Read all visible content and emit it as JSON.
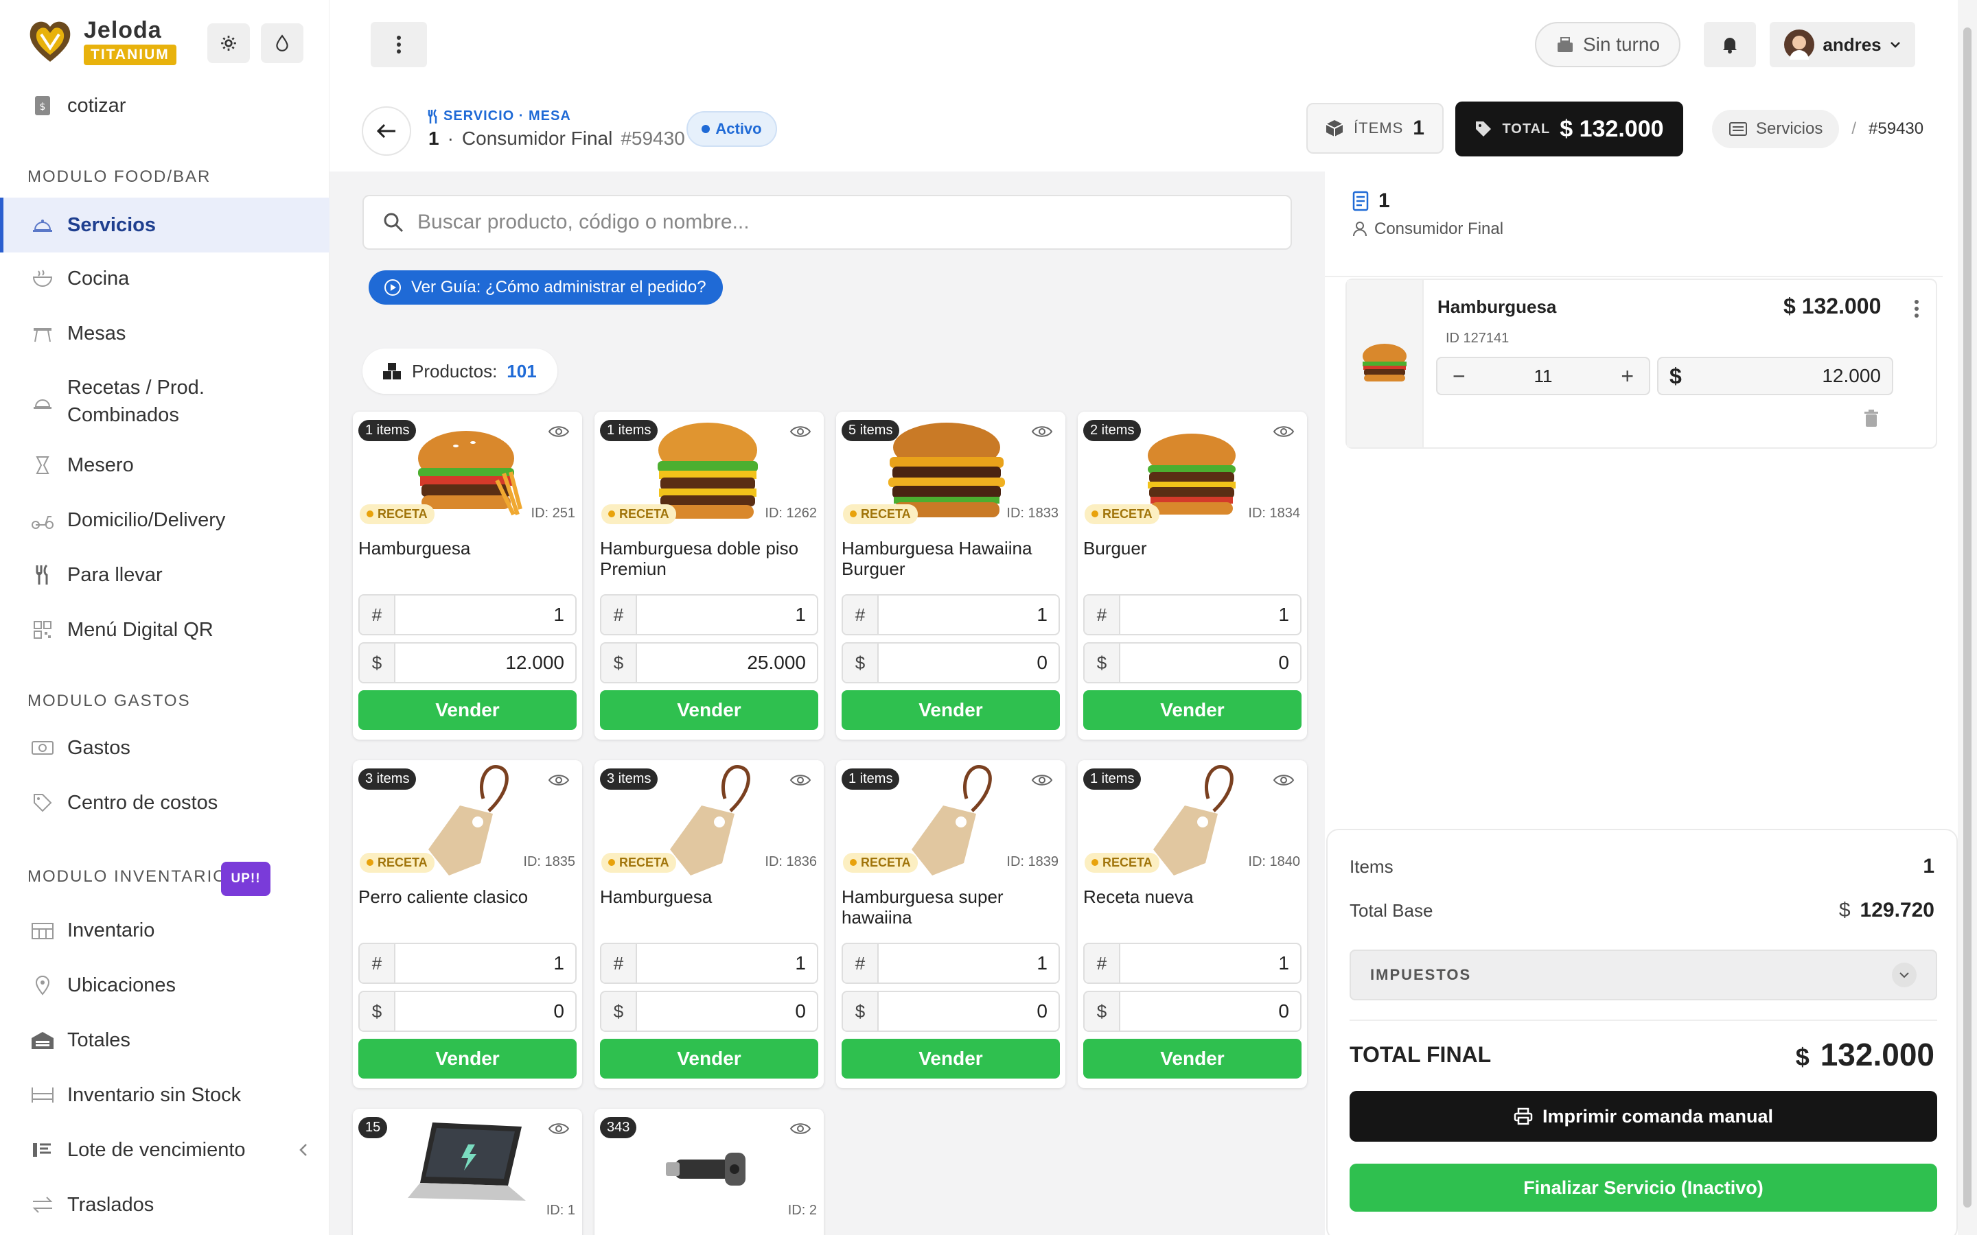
{
  "brand": {
    "name": "Jeloda",
    "tier": "TITANIUM"
  },
  "sidebar": {
    "top_item": "cotizar",
    "sections": [
      {
        "title": "MODULO FOOD/BAR"
      },
      {
        "title": "MODULO GASTOS"
      },
      {
        "title": "MODULO INVENTARIO",
        "badge": "UP!!"
      }
    ],
    "items": [
      {
        "label": "Servicios",
        "icon": "service-bell-icon"
      },
      {
        "label": "Cocina",
        "icon": "bowl-icon"
      },
      {
        "label": "Mesas",
        "icon": "table-icon"
      },
      {
        "label": "Recetas / Prod. Combinados",
        "icon": "recipe-icon"
      },
      {
        "label": "Mesero",
        "icon": "waiter-icon"
      },
      {
        "label": "Domicilio/Delivery",
        "icon": "scooter-icon"
      },
      {
        "label": "Para llevar",
        "icon": "utensils-icon"
      },
      {
        "label": "Menú Digital QR",
        "icon": "qr-icon"
      },
      {
        "label": "Gastos",
        "icon": "money-icon"
      },
      {
        "label": "Centro de costos",
        "icon": "tag-icon"
      },
      {
        "label": "Inventario",
        "icon": "warehouse-icon"
      },
      {
        "label": "Ubicaciones",
        "icon": "location-icon"
      },
      {
        "label": "Totales",
        "icon": "building-icon"
      },
      {
        "label": "Inventario sin Stock",
        "icon": "rack-icon"
      },
      {
        "label": "Lote de vencimiento",
        "icon": "batch-icon"
      },
      {
        "label": "Traslados",
        "icon": "transfer-icon"
      }
    ]
  },
  "topbar": {
    "shift_label": "Sin turno",
    "user": "andres"
  },
  "header": {
    "service_label": "SERVICIO · MESA",
    "table_number": "1",
    "separator": "·",
    "customer": "Consumidor Final",
    "order_id": "#59430",
    "status": "Activo",
    "items_label": "ÍTEMS",
    "items_count": "1",
    "total_label": "TOTAL",
    "total_value": "$ 132.000",
    "breadcrumb": {
      "section": "Servicios",
      "sep": "/",
      "current": "#59430"
    }
  },
  "search": {
    "placeholder": "Buscar producto, código o nombre..."
  },
  "guide_button": "Ver Guía: ¿Cómo administrar el pedido?",
  "products_summary": {
    "label": "Productos:",
    "count": "101"
  },
  "products": [
    {
      "badge": "1 items",
      "tag": "RECETA",
      "id": "ID: 251",
      "name": "Hamburguesa",
      "qty_prefix": "#",
      "qty": "1",
      "price_prefix": "$",
      "price": "12.000",
      "action": "Vender",
      "image": "burger"
    },
    {
      "badge": "1 items",
      "tag": "RECETA",
      "id": "ID: 1262",
      "name": "Hamburguesa doble piso Premiun",
      "qty_prefix": "#",
      "qty": "1",
      "price_prefix": "$",
      "price": "25.000",
      "action": "Vender",
      "image": "burger"
    },
    {
      "badge": "5 items",
      "tag": "RECETA",
      "id": "ID: 1833",
      "name": "Hamburguesa Hawaiina Burguer",
      "qty_prefix": "#",
      "qty": "1",
      "price_prefix": "$",
      "price": "0",
      "action": "Vender",
      "image": "burger"
    },
    {
      "badge": "2 items",
      "tag": "RECETA",
      "id": "ID: 1834",
      "name": "Burguer",
      "qty_prefix": "#",
      "qty": "1",
      "price_prefix": "$",
      "price": "0",
      "action": "Vender",
      "image": "burger"
    },
    {
      "badge": "3 items",
      "tag": "RECETA",
      "id": "ID: 1835",
      "name": "Perro caliente clasico",
      "qty_prefix": "#",
      "qty": "1",
      "price_prefix": "$",
      "price": "0",
      "action": "Vender",
      "image": "tag"
    },
    {
      "badge": "3 items",
      "tag": "RECETA",
      "id": "ID: 1836",
      "name": "Hamburguesa",
      "qty_prefix": "#",
      "qty": "1",
      "price_prefix": "$",
      "price": "0",
      "action": "Vender",
      "image": "tag"
    },
    {
      "badge": "1 items",
      "tag": "RECETA",
      "id": "ID: 1839",
      "name": "Hamburguesa super hawaiina",
      "qty_prefix": "#",
      "qty": "1",
      "price_prefix": "$",
      "price": "0",
      "action": "Vender",
      "image": "tag"
    },
    {
      "badge": "1 items",
      "tag": "RECETA",
      "id": "ID: 1840",
      "name": "Receta nueva",
      "qty_prefix": "#",
      "qty": "1",
      "price_prefix": "$",
      "price": "0",
      "action": "Vender",
      "image": "tag"
    },
    {
      "badge": "15",
      "id": "ID: 1",
      "image": "laptop"
    },
    {
      "badge": "343",
      "id": "ID: 2",
      "image": "usb"
    }
  ],
  "order": {
    "table": "1",
    "customer": "Consumidor Final",
    "line": {
      "name": "Hamburguesa",
      "price": "$ 132.000",
      "id": "ID 127141",
      "minus": "−",
      "qty": "11",
      "plus": "+",
      "unit_currency": "$",
      "unit_price": "12.000"
    }
  },
  "summary": {
    "items_label": "Items",
    "items_value": "1",
    "base_label": "Total Base",
    "base_currency": "$",
    "base_value": "129.720",
    "tax_label": "IMPUESTOS",
    "total_label": "TOTAL FINAL",
    "total_currency": "$",
    "total_value": "132.000",
    "print_button": "Imprimir comanda manual",
    "finish_button": "Finalizar Servicio (Inactivo)"
  },
  "colors": {
    "accent": "#1f6ad6",
    "success": "#2fc04f",
    "brand_gold": "#e8b20c",
    "dark": "#151515",
    "purple": "#7a3bd9"
  }
}
